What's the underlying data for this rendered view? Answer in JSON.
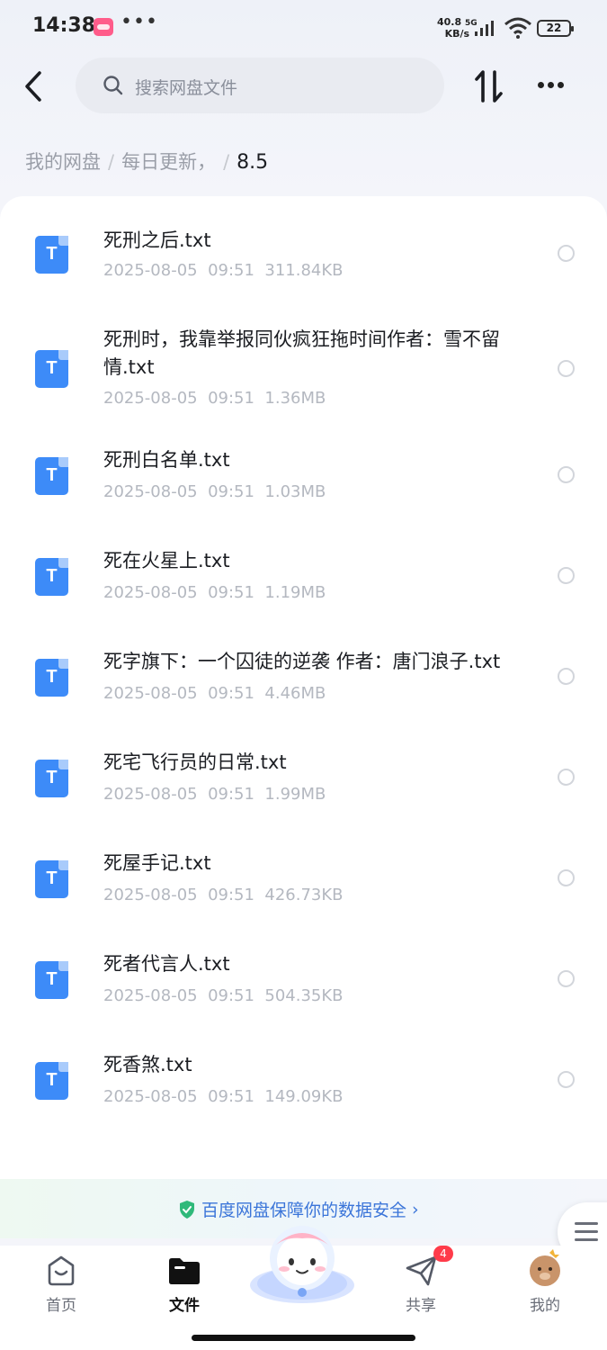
{
  "status_bar": {
    "time": "14:38",
    "dots": "•••",
    "speed_value": "40.8",
    "speed_unit": "KB/s",
    "network": "5G",
    "wifi_label": "6",
    "battery": "22"
  },
  "header": {
    "search_placeholder": "搜索网盘文件"
  },
  "breadcrumb": {
    "items": [
      "我的网盘",
      "每日更新，"
    ],
    "current": "8.5"
  },
  "files": [
    {
      "name": "死刑之后.txt",
      "date": "2025-08-05",
      "time": "09:51",
      "size": "311.84KB"
    },
    {
      "name": "死刑时，我靠举报同伙疯狂拖时间作者：雪不留情.txt",
      "date": "2025-08-05",
      "time": "09:51",
      "size": "1.36MB"
    },
    {
      "name": "死刑白名单.txt",
      "date": "2025-08-05",
      "time": "09:51",
      "size": "1.03MB"
    },
    {
      "name": "死在火星上.txt",
      "date": "2025-08-05",
      "time": "09:51",
      "size": "1.19MB"
    },
    {
      "name": "死字旗下：一个囚徒的逆袭 作者：唐门浪子.txt",
      "date": "2025-08-05",
      "time": "09:51",
      "size": "4.46MB"
    },
    {
      "name": "死宅飞行员的日常.txt",
      "date": "2025-08-05",
      "time": "09:51",
      "size": "1.99MB"
    },
    {
      "name": "死屋手记.txt",
      "date": "2025-08-05",
      "time": "09:51",
      "size": "426.73KB"
    },
    {
      "name": "死者代言人.txt",
      "date": "2025-08-05",
      "time": "09:51",
      "size": "504.35KB"
    },
    {
      "name": "死香煞.txt",
      "date": "2025-08-05",
      "time": "09:51",
      "size": "149.09KB"
    }
  ],
  "file_type_letter": "T",
  "safety_banner": {
    "text": "百度网盘保障你的数据安全",
    "arrow": "›"
  },
  "bottom_nav": {
    "items": [
      {
        "label": "首页",
        "icon": "home-icon"
      },
      {
        "label": "文件",
        "icon": "folder-icon",
        "active": true
      },
      {
        "label": "共享",
        "icon": "share-icon",
        "badge": "4"
      },
      {
        "label": "我的",
        "icon": "profile-avatar"
      }
    ]
  },
  "colors": {
    "accent": "#3b75d9",
    "file_icon": "#3d8bf8",
    "badge": "#ff3b4a"
  }
}
